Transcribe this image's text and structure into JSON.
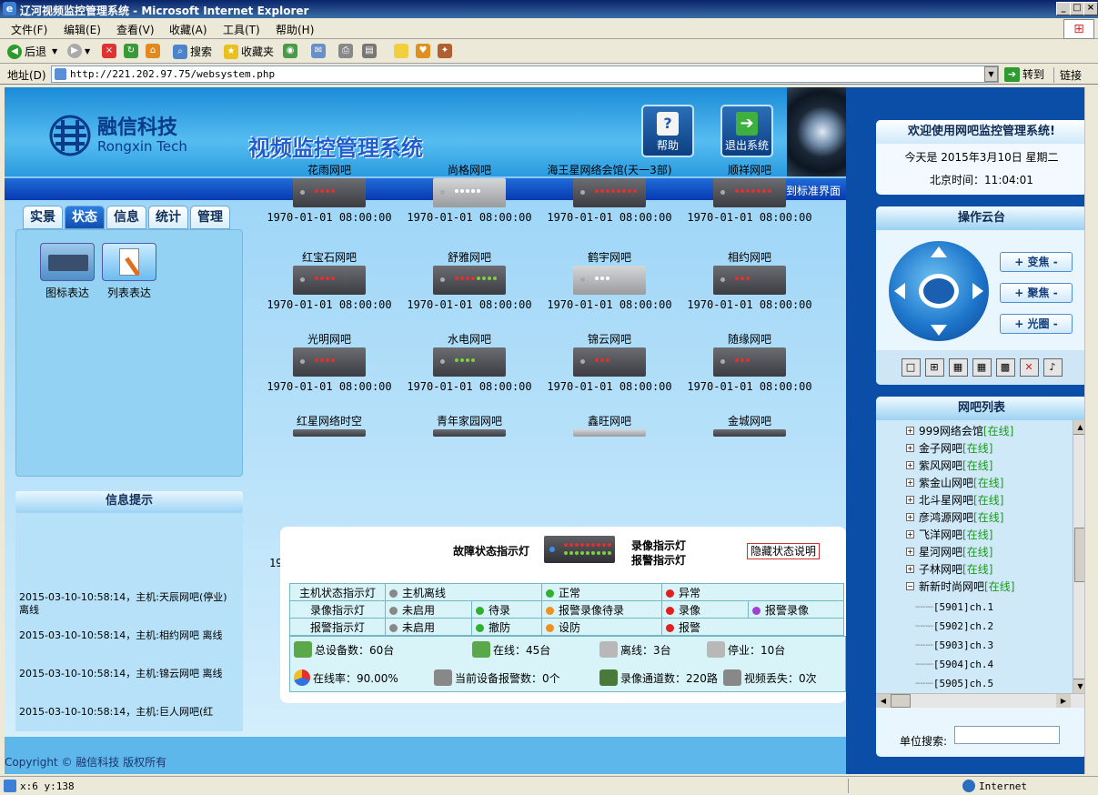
{
  "window": {
    "title": "辽河视频监控管理系统 - Microsoft Internet Explorer"
  },
  "menu": [
    "文件(F)",
    "编辑(E)",
    "查看(V)",
    "收藏(A)",
    "工具(T)",
    "帮助(H)"
  ],
  "toolbar": {
    "back": "后退",
    "search": "搜索",
    "favorites": "收藏夹"
  },
  "address": {
    "label": "地址(D)",
    "url": "http://221.202.97.75/websystem.php",
    "go": "转到",
    "links": "链接"
  },
  "brand": {
    "cn": "融信科技",
    "en": "Rongxin Tech",
    "system_title": "视频监控管理系统"
  },
  "header_buttons": {
    "help": "帮助",
    "exit": "退出系统"
  },
  "switch_link": ">>> 切换到标准界面",
  "tabs": [
    "实景",
    "状态",
    "信息",
    "统计",
    "管理"
  ],
  "active_tab": "状态",
  "left_options": {
    "icon_view": "图标表达",
    "list_view": "列表表达"
  },
  "info": {
    "title": "信息提示",
    "logs": [
      "2015-03-10-10:58:14，主机:天辰网吧(停业) 离线",
      "2015-03-10-10:58:14，主机:相约网吧 离线",
      "2015-03-10-10:58:14，主机:锦云网吧 离线",
      "2015-03-10-10:58:14，主机:巨人网吧(红"
    ]
  },
  "copyright": "Copyright © 融信科技 版权所有",
  "devices": [
    {
      "name": "花雨网吧",
      "time": "1970-01-01 08:00:00",
      "style": "dark",
      "dots": [
        "#e03030",
        "#e03030",
        "#e03030",
        "#e03030"
      ]
    },
    {
      "name": "尚格网吧",
      "time": "1970-01-01 08:00:00",
      "style": "light",
      "dots": [
        "#ffffff",
        "#ffffff",
        "#ffffff",
        "#ffffff",
        "#ffffff"
      ]
    },
    {
      "name": "海王星网络会馆(天一3部)",
      "time": "1970-01-01 08:00:00",
      "style": "dark",
      "dots": [
        "#e03030",
        "#e03030",
        "#e03030",
        "#e03030",
        "#e03030",
        "#e03030",
        "#e03030",
        "#e03030"
      ]
    },
    {
      "name": "顺祥网吧",
      "time": "1970-01-01 08:00:00",
      "style": "dark",
      "dots": [
        "#e03030",
        "#e03030",
        "#e03030",
        "#e03030",
        "#e03030",
        "#e03030",
        "#e03030"
      ]
    },
    {
      "name": "红宝石网吧",
      "time": "1970-01-01 08:00:00",
      "style": "dark",
      "dots": [
        "#e03030",
        "#e03030",
        "#e03030",
        "#e03030"
      ]
    },
    {
      "name": "舒雅网吧",
      "time": "1970-01-01 08:00:00",
      "style": "dark",
      "dots": [
        "#e03030",
        "#e03030",
        "#e03030",
        "#e03030",
        "#7cd040",
        "#7cd040",
        "#7cd040",
        "#7cd040"
      ]
    },
    {
      "name": "鹤宇网吧",
      "time": "1970-01-01 08:00:00",
      "style": "light",
      "dots": [
        "#ffffff",
        "#ffffff",
        "#ffffff"
      ]
    },
    {
      "name": "相约网吧",
      "time": "1970-01-01 08:00:00",
      "style": "dark",
      "dots": [
        "#e03030",
        "#e03030",
        "#e03030"
      ]
    },
    {
      "name": "光明网吧",
      "time": "1970-01-01 08:00:00",
      "style": "dark",
      "dots": [
        "#e03030",
        "#e03030",
        "#e03030",
        "#e03030"
      ]
    },
    {
      "name": "水电网吧",
      "time": "1970-01-01 08:00:00",
      "style": "dark",
      "dots": [
        "#7cd040",
        "#7cd040",
        "#7cd040",
        "#7cd040"
      ]
    },
    {
      "name": "锦云网吧",
      "time": "1970-01-01 08:00:00",
      "style": "dark",
      "dots": [
        "#e03030",
        "#e03030",
        "#e03030"
      ]
    },
    {
      "name": "随缘网吧",
      "time": "1970-01-01 08:00:00",
      "style": "dark",
      "dots": [
        "#e03030",
        "#e03030",
        "#e03030"
      ]
    },
    {
      "name": "红星网络时空",
      "time": "",
      "style": "dark",
      "dots": []
    },
    {
      "name": "青年家园网吧",
      "time": "",
      "style": "dark",
      "dots": []
    },
    {
      "name": "鑫旺网吧",
      "time": "",
      "style": "light",
      "dots": []
    },
    {
      "name": "金城网吧",
      "time": "",
      "style": "dark",
      "dots": []
    }
  ],
  "partial_time_prefix": "19",
  "legend": {
    "fault_light": "故障状态指示灯",
    "record_light": "录像指示灯",
    "alarm_light": "报警指示灯",
    "hide_button": "隐藏状态说明",
    "rows": [
      {
        "label": "主机状态指示灯",
        "items": [
          {
            "c": "#888888",
            "t": "主机离线"
          },
          {
            "c": "#30b030",
            "t": "正常"
          },
          {
            "c": "#e02020",
            "t": "异常"
          }
        ]
      },
      {
        "label": "录像指示灯",
        "items": [
          {
            "c": "#888888",
            "t": "未启用"
          },
          {
            "c": "#30b030",
            "t": "待录"
          },
          {
            "c": "#f09020",
            "t": "报警录像待录"
          },
          {
            "c": "#e02020",
            "t": "录像"
          },
          {
            "c": "#a040d0",
            "t": "报警录像"
          }
        ]
      },
      {
        "label": "报警指示灯",
        "items": [
          {
            "c": "#888888",
            "t": "未启用"
          },
          {
            "c": "#30b030",
            "t": "撤防"
          },
          {
            "c": "#f09020",
            "t": "设防"
          },
          {
            "c": "#e02020",
            "t": "报警"
          }
        ]
      }
    ],
    "stats": {
      "total": "总设备数：60台",
      "online": "在线：45台",
      "offline": "离线：3台",
      "stopped": "停业：10台",
      "rate": "在线率：90.00%",
      "alarms": "当前设备报警数：0个",
      "channels": "录像通道数：220路",
      "video_loss": "视频丢失：0次"
    }
  },
  "welcome": {
    "title": "欢迎使用网吧监控管理系统!",
    "date": "今天是 2015年3月10日 星期二",
    "time": "北京时间：11:04:01"
  },
  "ptz": {
    "title": "操作云台",
    "zoom": "+ 变焦 -",
    "focus": "+ 聚焦 -",
    "iris": "+ 光圈 -"
  },
  "netbar_list": {
    "title": "网吧列表",
    "items": [
      {
        "name": "999网络会馆",
        "status": "[在线]",
        "sign": "+"
      },
      {
        "name": "金子网吧",
        "status": "[在线]",
        "sign": "+"
      },
      {
        "name": "紫风网吧",
        "status": "[在线]",
        "sign": "+"
      },
      {
        "name": "紫金山网吧",
        "status": "[在线]",
        "sign": "+"
      },
      {
        "name": "北斗星网吧",
        "status": "[在线]",
        "sign": "+"
      },
      {
        "name": "彦鸿源网吧",
        "status": "[在线]",
        "sign": "+"
      },
      {
        "name": "飞洋网吧",
        "status": "[在线]",
        "sign": "+"
      },
      {
        "name": "星河网吧",
        "status": "[在线]",
        "sign": "+"
      },
      {
        "name": "子林网吧",
        "status": "[在线]",
        "sign": "+"
      },
      {
        "name": "新新时尚网吧",
        "status": "[在线]",
        "sign": "−"
      }
    ],
    "channels": [
      "[5901]ch.1",
      "[5902]ch.2",
      "[5903]ch.3",
      "[5904]ch.4",
      "[5905]ch.5"
    ]
  },
  "unit_search": {
    "label": "单位搜索:",
    "value": ""
  },
  "statusbar": {
    "coords": "x:6 y:138",
    "zone": "Internet"
  }
}
